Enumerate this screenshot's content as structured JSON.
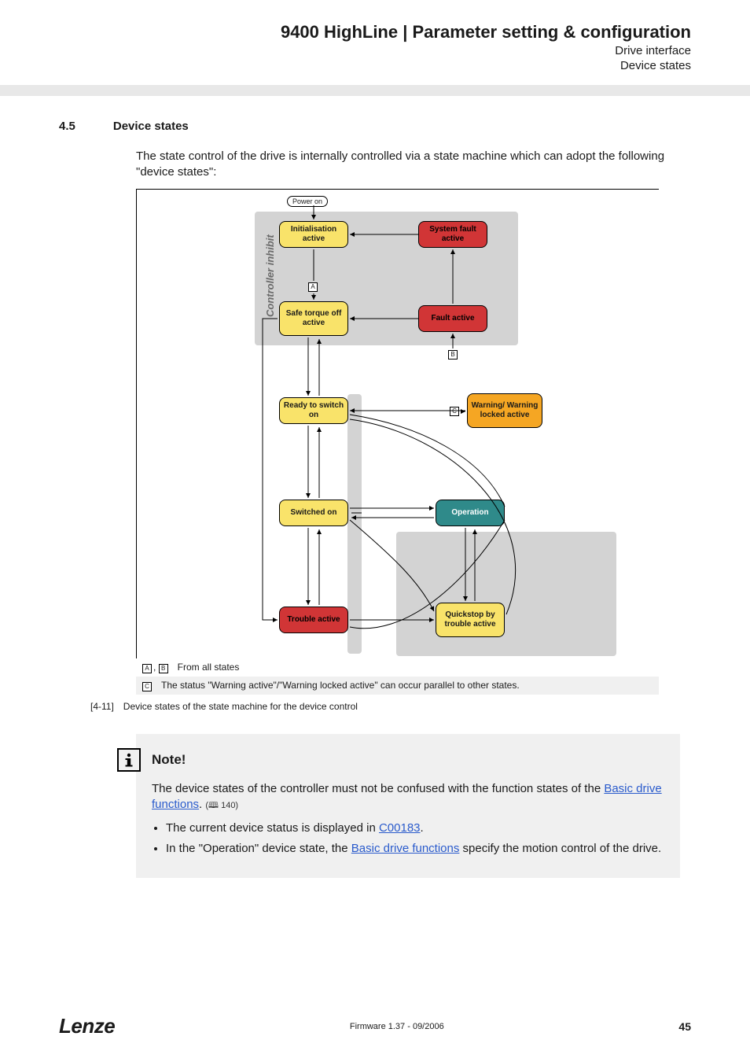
{
  "header": {
    "title": "9400 HighLine | Parameter setting & configuration",
    "sub1": "Drive interface",
    "sub2": "Device states"
  },
  "section": {
    "num": "4.5",
    "title": "Device states",
    "intro": "The state control of the drive is internally controlled via a state machine which can adopt the following \"device states\":"
  },
  "diagram": {
    "inhibit_label": "Controller inhibit",
    "power_on": "Power on",
    "states": {
      "init": "Initialisation active",
      "sysfault": "System fault active",
      "sto": "Safe torque off active",
      "fault": "Fault active",
      "ready": "Ready to switch on",
      "warning": "Warning/ Warning locked active",
      "switched": "Switched on",
      "operation": "Operation",
      "trouble": "Trouble active",
      "quickstop": "Quickstop by trouble active"
    },
    "marks": {
      "a": "A",
      "b": "B",
      "c": "C"
    }
  },
  "legend": {
    "ab_label": "From all states",
    "c_label": "The status \"Warning active\"/\"Warning locked active\" can occur parallel to other states."
  },
  "caption": {
    "ref": "[4-11]",
    "text": "Device states of the state machine for the device control"
  },
  "note": {
    "title": "Note!",
    "body_pre": "The device states of the controller must not be confused with the function states of the ",
    "link1": "Basic drive functions",
    "body_post": ". ",
    "pageref": "(🕮 140)",
    "bullet1_pre": "The current device status is displayed in ",
    "bullet1_link": "C00183",
    "bullet1_post": ".",
    "bullet2_pre": "In the \"Operation\" device state, the ",
    "bullet2_link": "Basic drive functions",
    "bullet2_post": " specify the motion control of the drive."
  },
  "footer": {
    "logo": "Lenze",
    "fw": "Firmware 1.37 - 09/2006",
    "page": "45"
  }
}
